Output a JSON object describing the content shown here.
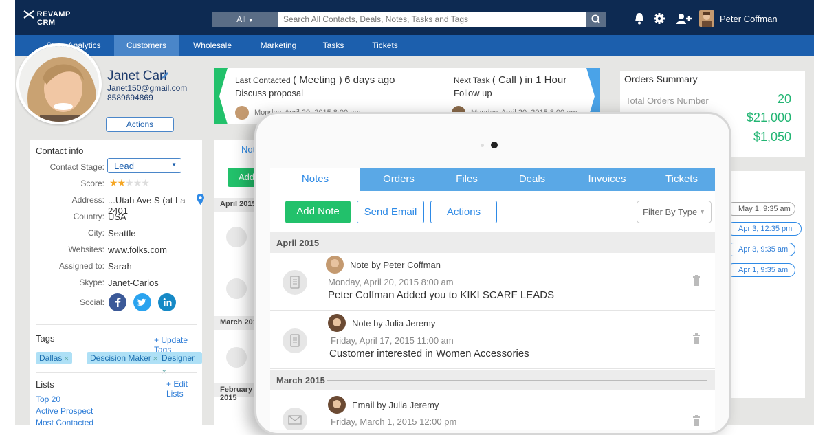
{
  "app": {
    "logo_line1": "REVAMP",
    "logo_line2": "CRM"
  },
  "search": {
    "scope": "All",
    "placeholder": "Search All Contacts, Deals, Notes, Tasks and Tags"
  },
  "user": {
    "name": "Peter Coffman"
  },
  "nav": [
    "Store Analytics",
    "Customers",
    "Wholesale",
    "Marketing",
    "Tasks",
    "Tickets"
  ],
  "contact": {
    "name": "Janet Carl",
    "email": "Janet150@gmail.com",
    "phone": "8589694869",
    "actions_label": "Actions"
  },
  "contact_info": {
    "title": "Contact info",
    "fields": [
      {
        "label": "Contact Stage:",
        "value": "Lead"
      },
      {
        "label": "Score:",
        "value": ""
      },
      {
        "label": "Address:",
        "value": "...Utah Ave S (at La 2401"
      },
      {
        "label": "Country:",
        "value": "USA"
      },
      {
        "label": "City:",
        "value": "Seattle"
      },
      {
        "label": "Websites:",
        "value": "www.folks.com"
      },
      {
        "label": "Assigned to:",
        "value": "Sarah"
      },
      {
        "label": "Skype:",
        "value": "Janet-Carlos"
      },
      {
        "label": "Social:",
        "value": ""
      }
    ],
    "score": 2,
    "score_max": 5
  },
  "tags": {
    "title": "Tags",
    "update_link": "+ Update Tags",
    "items": [
      "Dallas",
      "Descision Maker",
      "Designer"
    ]
  },
  "lists": {
    "title": "Lists",
    "edit_link": "+ Edit Lists",
    "items": [
      "Top 20",
      "Active Prospect",
      "Most Contacted"
    ]
  },
  "banner": {
    "last_label": "Last Contacted",
    "last_type": "( Meeting )",
    "last_when": "6 days ago",
    "last_subject": "Discuss proposal",
    "last_date": "Monday, April 20, 2015 8:00 am",
    "next_label": "Next Task",
    "next_type": "( Call )",
    "next_when": "in 1 Hour",
    "next_subject": "Follow up",
    "next_date": "Monday, April 20, 2015 8:00 am"
  },
  "orders_summary": {
    "title": "Orders Summary",
    "total_label": "Total Orders Number",
    "total_value": "20",
    "revenue": "$21,000",
    "average": "$1,050"
  },
  "bg_timeline": {
    "tab": "Notes",
    "add": "Add",
    "months": [
      "April 2015",
      "March 2015",
      "February 2015"
    ],
    "dates": [
      "May 1, 9:35 am",
      "Apr 3, 12:35 pm",
      "Apr 3, 9:35 am",
      "Apr 1, 9:35 am"
    ]
  },
  "tablet": {
    "tabs": [
      "Notes",
      "Orders",
      "Files",
      "Deals",
      "Invoices",
      "Tickets"
    ],
    "add_note": "Add Note",
    "send_email": "Send Email",
    "actions": "Actions",
    "filter": "Filter By Type",
    "sections": [
      {
        "month": "April 2015",
        "notes": [
          {
            "author": "Note by Peter Coffman",
            "date": "Monday, April 20, 2015  8:00 am",
            "text": "Peter Coffman Added you to KIKI SCARF LEADS"
          },
          {
            "author": "Note by Julia Jeremy",
            "date": "Friday, April 17,  2015  11:00 am",
            "text": "Customer interested in Women Accessories"
          }
        ]
      },
      {
        "month": "March 2015",
        "notes": [
          {
            "author": "Email by Julia Jeremy",
            "date": "Friday, March 1, 2015  12:00 pm",
            "text": ""
          }
        ]
      }
    ]
  }
}
